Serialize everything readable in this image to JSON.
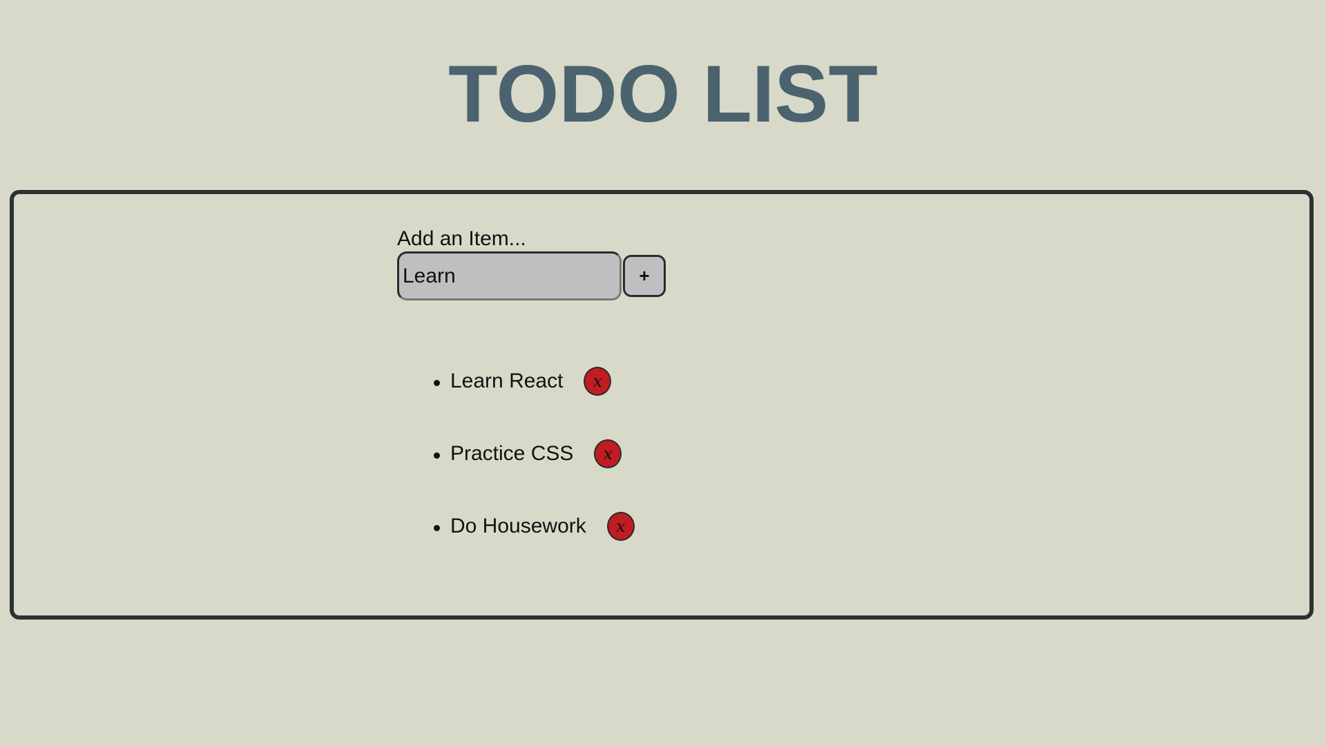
{
  "header": {
    "title": "TODO LIST"
  },
  "form": {
    "label": "Add an Item...",
    "input_value": "Learn",
    "add_button_label": "+"
  },
  "todos": [
    {
      "text": "Learn React",
      "delete_label": "x"
    },
    {
      "text": "Practice CSS",
      "delete_label": "x"
    },
    {
      "text": "Do Housework",
      "delete_label": "x"
    }
  ],
  "colors": {
    "background": "#d9d9c9",
    "title": "#4a636e",
    "panel_border": "#2b3332",
    "input_fill": "#bfbfc1",
    "delete_button": "#c01d23"
  }
}
